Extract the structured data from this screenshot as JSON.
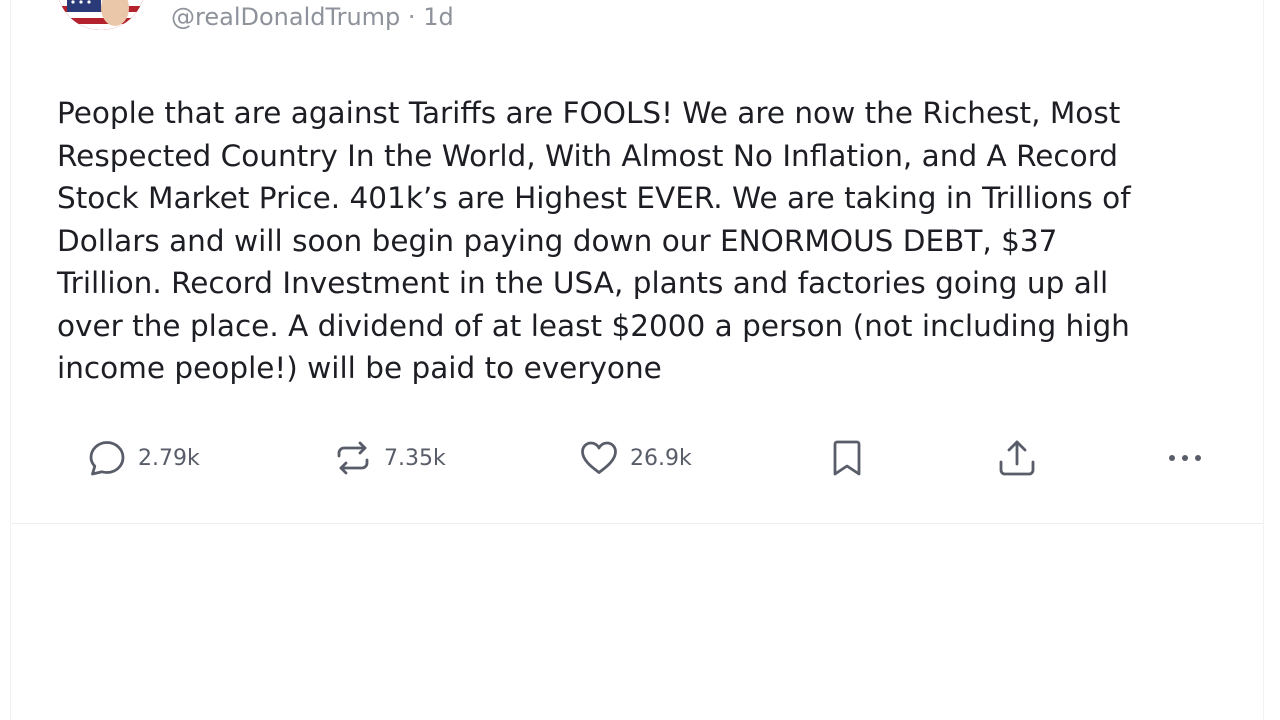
{
  "post": {
    "author_handle": "@realDonaldTrump",
    "separator": " · ",
    "timestamp": "1d",
    "text": "People that are against Tariffs are FOOLS! We are now the Richest, Most\nRespected Country In the World, With Almost No Inflation, and A Record\nStock Market Price. 401k’s are Highest EVER. We are taking in Trillions of\nDollars and will soon begin paying down our ENORMOUS DEBT, $37\nTrillion. Record Investment in the USA, plants and factories going up all\nover the place. A dividend of at least $2000 a person (not including high\nincome people!) will be paid to everyone"
  },
  "actions": {
    "reply": {
      "icon": "comment-bubble-icon",
      "count": "2.79k"
    },
    "repost": {
      "icon": "repost-arrows-icon",
      "count": "7.35k"
    },
    "like": {
      "icon": "heart-icon",
      "count": "26.9k"
    },
    "bookmark": {
      "icon": "bookmark-icon"
    },
    "share": {
      "icon": "share-upload-icon"
    },
    "more": {
      "icon": "more-dots-icon"
    }
  },
  "colors": {
    "text": "#1c1e24",
    "meta": "#8e929b",
    "icon": "#585d69",
    "divider": "#eceef1"
  }
}
